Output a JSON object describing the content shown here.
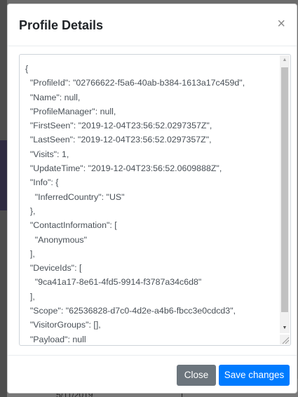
{
  "background": {
    "cells": [
      "5/11/2019",
      "1"
    ]
  },
  "modal": {
    "title": "Profile Details",
    "close_glyph": "×",
    "close_icon": "close-icon",
    "json_lines": [
      "{",
      "  \"ProfileId\": \"02766622-f5a6-40ab-b384-1613a17c459d\",",
      "  \"Name\": null,",
      "  \"ProfileManager\": null,",
      "  \"FirstSeen\": \"2019-12-04T23:56:52.0297357Z\",",
      "  \"LastSeen\": \"2019-12-04T23:56:52.0297357Z\",",
      "  \"Visits\": 1,",
      "  \"UpdateTime\": \"2019-12-04T23:56:52.0609888Z\",",
      "  \"Info\": {",
      "    \"InferredCountry\": \"US\"",
      "  },",
      "  \"ContactInformation\": [",
      "    \"Anonymous\"",
      "  ],",
      "  \"DeviceIds\": [",
      "    \"9ca41a17-8e61-4fd5-9914-f3787a34c6d8\"",
      "  ],",
      "  \"Scope\": \"62536828-d7c0-4d2e-a4b6-fbcc3e0cdcd3\",",
      "  \"VisitorGroups\": [],",
      "  \"Payload\": null",
      "}"
    ],
    "footer": {
      "close_label": "Close",
      "save_label": "Save changes"
    }
  },
  "colors": {
    "primary": "#007bff",
    "secondary": "#6c757d"
  }
}
